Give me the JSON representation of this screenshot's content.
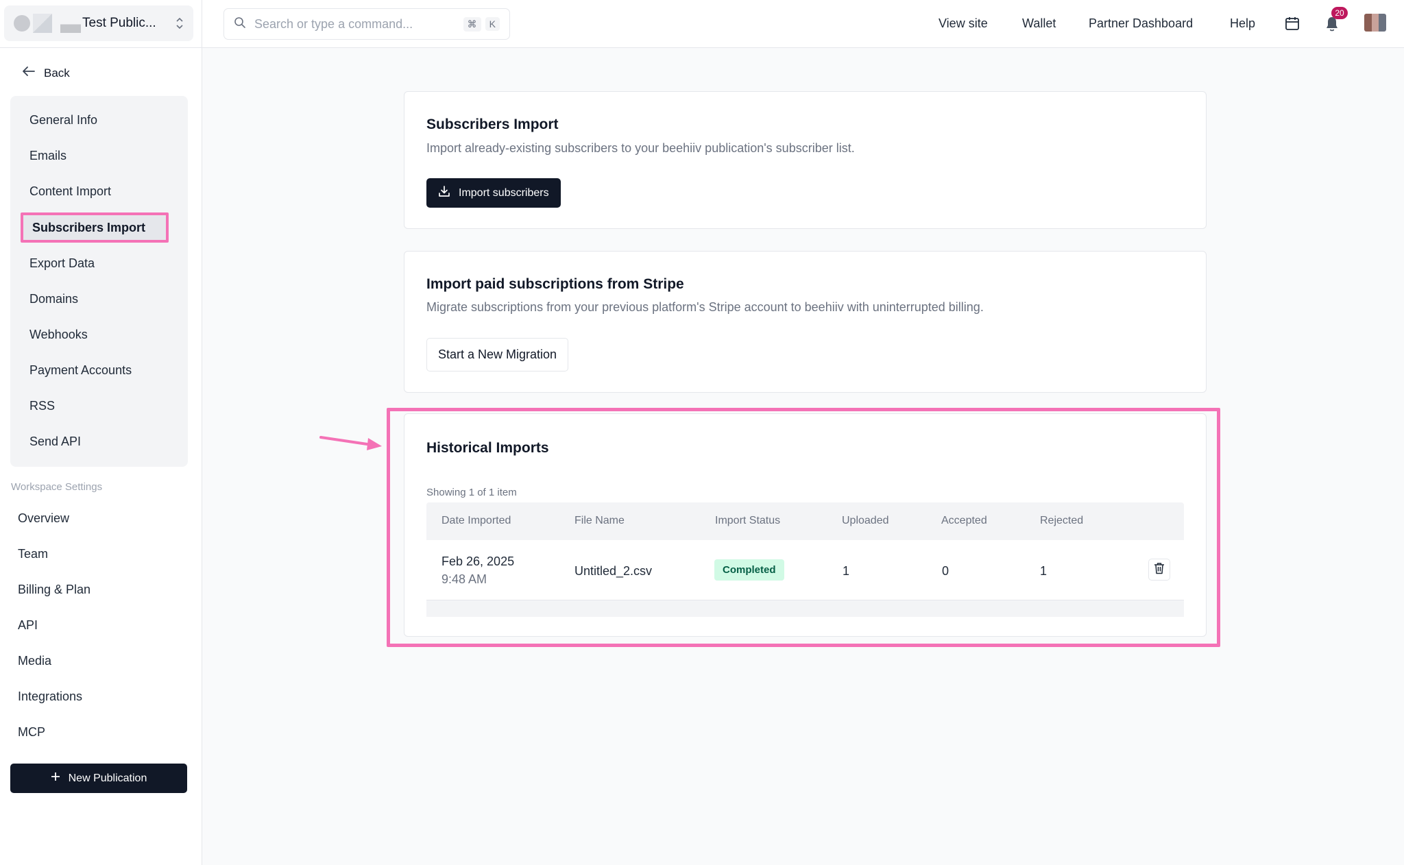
{
  "sidebar": {
    "publication_name": "Test Public...",
    "back_label": "Back",
    "settings_items": [
      {
        "label": "General Info"
      },
      {
        "label": "Emails"
      },
      {
        "label": "Content Import"
      },
      {
        "label": "Subscribers Import",
        "active": true
      },
      {
        "label": "Export Data"
      },
      {
        "label": "Domains"
      },
      {
        "label": "Webhooks"
      },
      {
        "label": "Payment Accounts"
      },
      {
        "label": "RSS"
      },
      {
        "label": "Send API"
      }
    ],
    "workspace_label": "Workspace Settings",
    "workspace_items": [
      {
        "label": "Overview"
      },
      {
        "label": "Team"
      },
      {
        "label": "Billing & Plan"
      },
      {
        "label": "API"
      },
      {
        "label": "Media"
      },
      {
        "label": "Integrations"
      },
      {
        "label": "MCP"
      }
    ],
    "new_publication_label": "New Publication"
  },
  "topbar": {
    "search_placeholder": "Search or type a command...",
    "shortcut_cmd": "⌘",
    "shortcut_key": "K",
    "links": [
      "View site",
      "Wallet",
      "Partner Dashboard",
      "Help"
    ],
    "notification_count": "20",
    "icons": [
      "search-icon",
      "calendar-icon",
      "bell-icon",
      "avatar"
    ]
  },
  "subscribers_import": {
    "title": "Subscribers Import",
    "description": "Import already-existing subscribers to your beehiiv publication's subscriber list.",
    "button_label": "Import subscribers"
  },
  "stripe_import": {
    "title": "Import paid subscriptions from Stripe",
    "description": "Migrate subscriptions from your previous platform's Stripe account to beehiiv with uninterrupted billing.",
    "button_label": "Start a New Migration"
  },
  "historical_imports": {
    "title": "Historical Imports",
    "showing": "Showing 1 of 1 item",
    "columns": [
      "Date Imported",
      "File Name",
      "Import Status",
      "Uploaded",
      "Accepted",
      "Rejected"
    ],
    "rows": [
      {
        "date": "Feb 26, 2025",
        "time": "9:48 AM",
        "file_name": "Untitled_2.csv",
        "status": "Completed",
        "uploaded": "1",
        "accepted": "0",
        "rejected": "1"
      }
    ]
  },
  "colors": {
    "accent_highlight": "#f472b6",
    "primary_dark": "#111827",
    "status_completed_bg": "#d1fae5",
    "status_completed_text": "#065f46",
    "badge": "#be185d"
  }
}
